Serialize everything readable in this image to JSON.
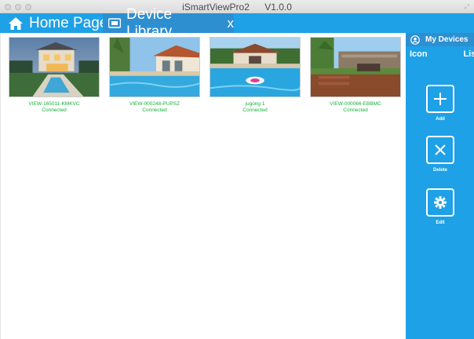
{
  "window": {
    "app_name": "iSmartViewPro2",
    "version": "V1.0.0"
  },
  "tabs": {
    "home_label": "Home Page",
    "device_label": "Device Library",
    "close_label": "x"
  },
  "devices": [
    {
      "name": "VIEW-165011-KMKVC",
      "status": "Connected"
    },
    {
      "name": "VIEW-000248-PUPSZ",
      "status": "Connected"
    },
    {
      "name": "jugong 1",
      "status": "Connected"
    },
    {
      "name": "VIEW-000066-EBBMC",
      "status": "Connected"
    }
  ],
  "sidebar": {
    "title": "My Devices",
    "view_icon": "Icon",
    "view_list": "List",
    "actions": {
      "add": "Add",
      "delete": "Delete",
      "edit": "Edit"
    }
  },
  "icons": {
    "home": "home-icon",
    "library": "folder-icon",
    "my_devices": "user-icon",
    "add": "plus-icon",
    "delete": "x-icon",
    "edit": "gear-icon"
  },
  "colors": {
    "accent": "#1ea1e6",
    "accent_dark": "#2d8fd0",
    "status_green": "#18b13a"
  }
}
